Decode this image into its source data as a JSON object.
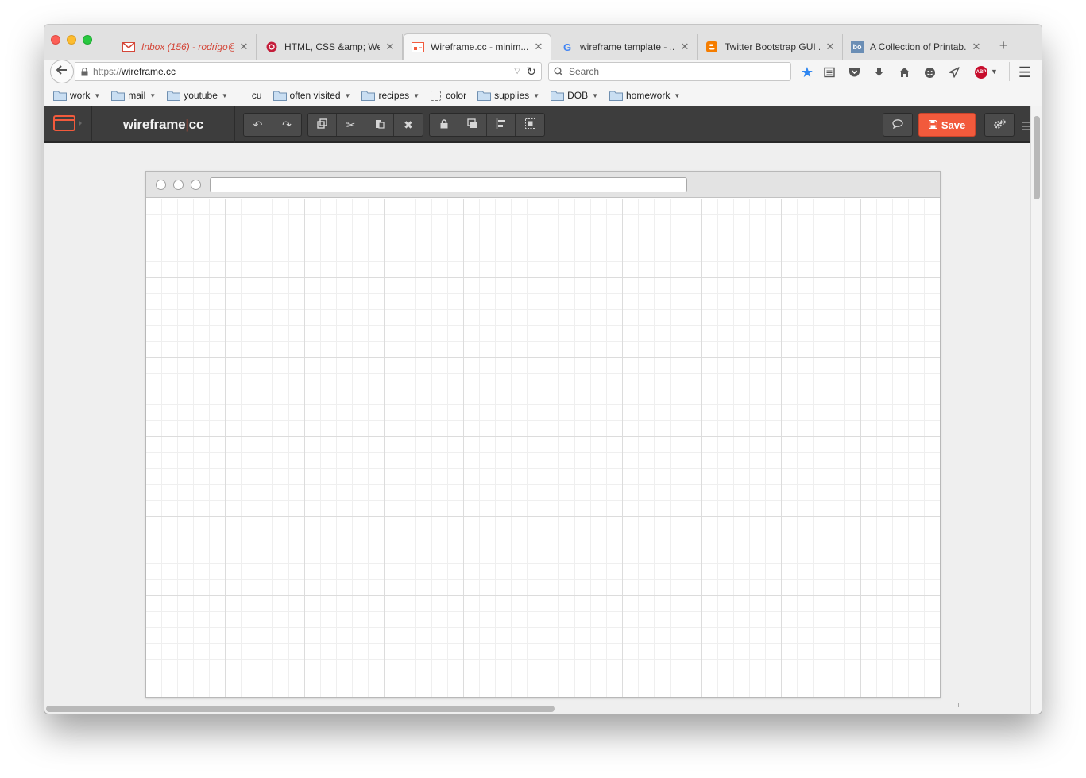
{
  "tabs": [
    {
      "title": "Inbox (156) - rodrigo@...",
      "icon": "gmail-icon"
    },
    {
      "title": "HTML, CSS &amp; We...",
      "icon": "html-site-icon"
    },
    {
      "title": "Wireframe.cc - minim...",
      "icon": "wireframe-icon",
      "active": true
    },
    {
      "title": "wireframe template - ...",
      "icon": "google-icon"
    },
    {
      "title": "Twitter Bootstrap GUI ...",
      "icon": "blogger-icon"
    },
    {
      "title": "A Collection of Printab...",
      "icon": "bo-icon",
      "icon_text": "bo"
    }
  ],
  "newtab_label": "+",
  "navbar": {
    "url_scheme": "https://",
    "url_host": "wireframe.cc",
    "search_placeholder": "Search",
    "abp_label": "ABP"
  },
  "bookmarks": [
    {
      "label": "work",
      "type": "folder",
      "dropdown": true
    },
    {
      "label": "mail",
      "type": "folder",
      "dropdown": true
    },
    {
      "label": "youtube",
      "type": "folder",
      "dropdown": true
    },
    {
      "label": "cu",
      "type": "plain",
      "dropdown": false
    },
    {
      "label": "often visited",
      "type": "folder",
      "dropdown": true
    },
    {
      "label": "recipes",
      "type": "folder",
      "dropdown": true
    },
    {
      "label": "color",
      "type": "page",
      "dropdown": false
    },
    {
      "label": "supplies",
      "type": "folder",
      "dropdown": true
    },
    {
      "label": "DOB",
      "type": "folder",
      "dropdown": true
    },
    {
      "label": "homework",
      "type": "folder",
      "dropdown": true
    }
  ],
  "app": {
    "logo_left": "wireframe",
    "logo_sep": "|",
    "logo_right": "cc",
    "save_label": "Save",
    "accent": "#f25a3c",
    "toolbar_groups": [
      [
        "undo-icon",
        "redo-icon"
      ],
      [
        "copy-icon",
        "cut-icon",
        "paste-icon",
        "delete-icon"
      ],
      [
        "lock-icon",
        "arrange-icon",
        "align-icon",
        "group-icon"
      ]
    ]
  }
}
